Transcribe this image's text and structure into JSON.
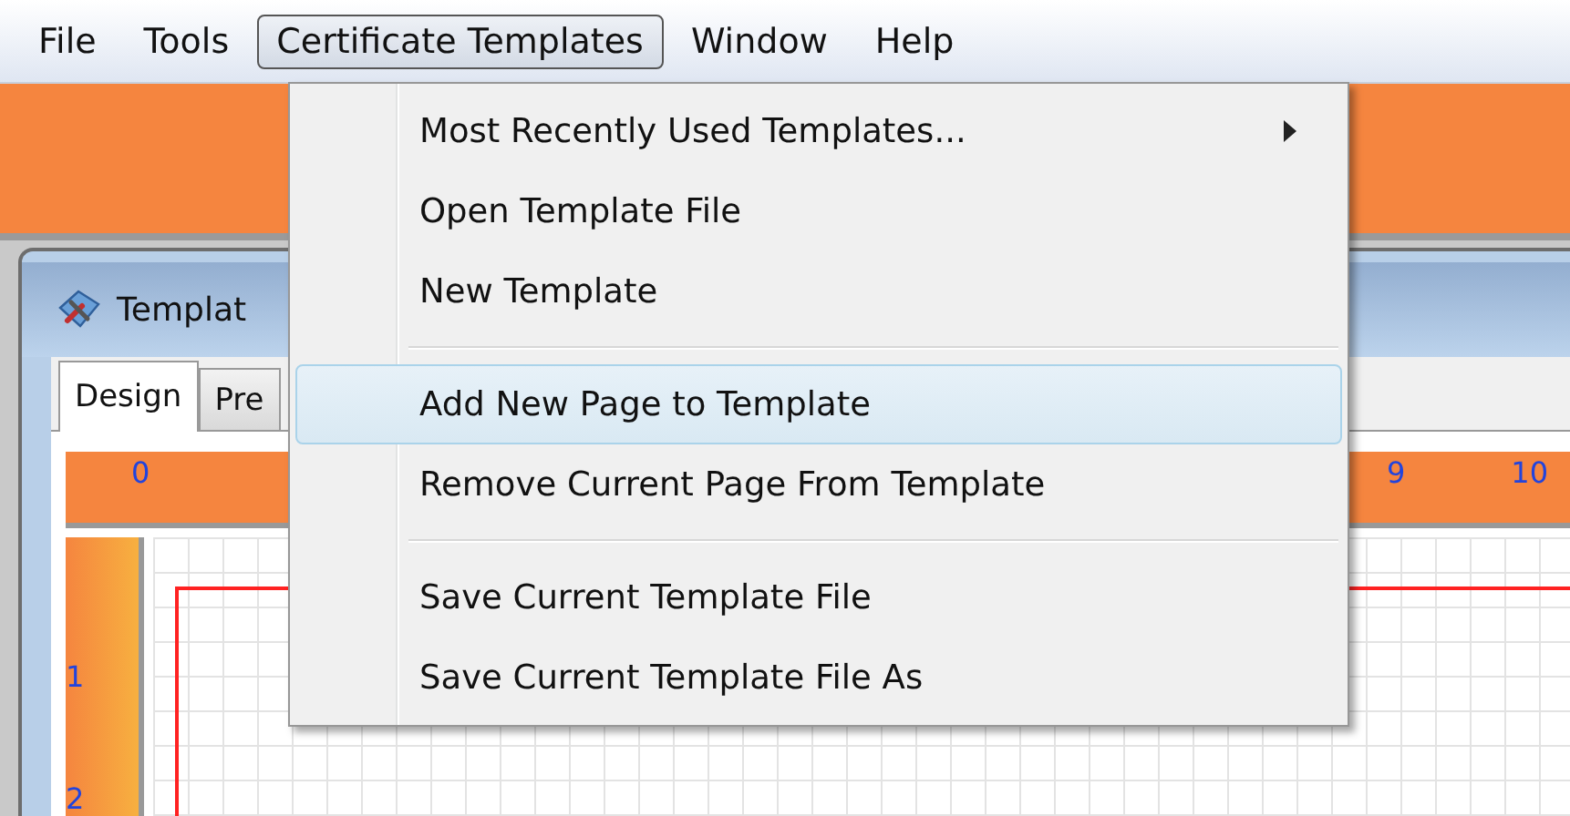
{
  "menu_bar": [
    {
      "label": "File",
      "selected": false
    },
    {
      "label": "Tools",
      "selected": false
    },
    {
      "label": "Certificate Templates",
      "selected": true
    },
    {
      "label": "Window",
      "selected": false
    },
    {
      "label": "Help",
      "selected": false
    }
  ],
  "document_window": {
    "title": "Templat",
    "tabs": [
      {
        "label": "Design",
        "selected": true
      },
      {
        "label": "Pre",
        "selected": false
      }
    ],
    "top_ruler": {
      "labels": [
        "0",
        "9",
        "10"
      ]
    },
    "side_ruler": {
      "labels": [
        "1",
        "2"
      ]
    }
  },
  "dropdown_menu": {
    "items": [
      {
        "kind": "submenu",
        "label": "Most Recently Used Templates...",
        "selected": false
      },
      {
        "kind": "item",
        "label": "Open Template File",
        "selected": false
      },
      {
        "kind": "item",
        "label": "New Template",
        "selected": false
      },
      {
        "kind": "separator"
      },
      {
        "kind": "item",
        "label": "Add New Page to Template",
        "selected": true
      },
      {
        "kind": "item",
        "label": "Remove Current Page From Template",
        "selected": false
      },
      {
        "kind": "separator"
      },
      {
        "kind": "item",
        "label": "Save Current Template File",
        "selected": false
      },
      {
        "kind": "item",
        "label": "Save Current Template File As",
        "selected": false
      }
    ]
  }
}
